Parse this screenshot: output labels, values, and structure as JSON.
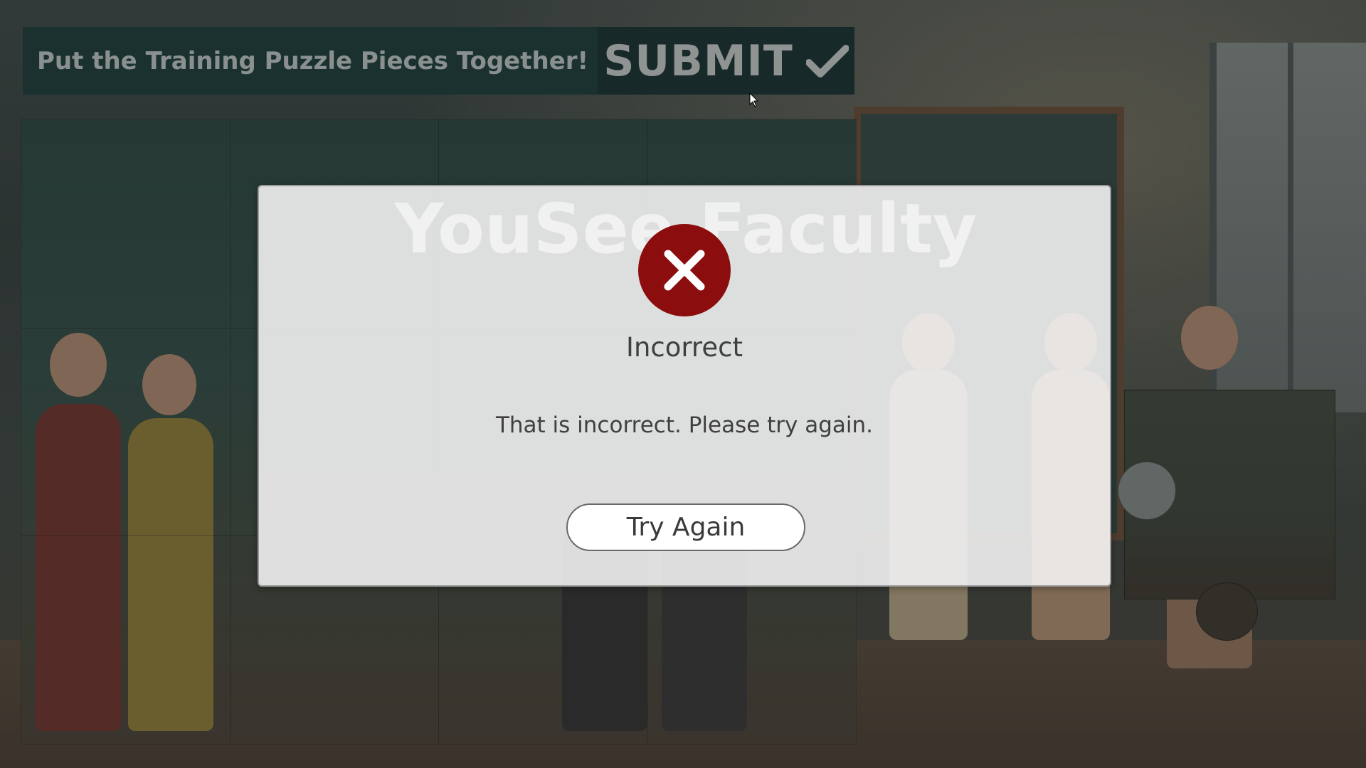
{
  "header": {
    "title": "Put the Training Puzzle Pieces Together!",
    "submit_label": "SUBMIT",
    "submit_icon": "check-icon"
  },
  "modal": {
    "watermark": "YouSee Faculty",
    "icon": "close-circle-icon",
    "icon_color": "#8b0d0d",
    "title": "Incorrect",
    "message": "That is incorrect. Please try again.",
    "button_label": "Try Again"
  },
  "colors": {
    "header_bg": "#0f3a38",
    "submit_bg": "#0a2d2b",
    "error_red": "#8b0d0d"
  }
}
